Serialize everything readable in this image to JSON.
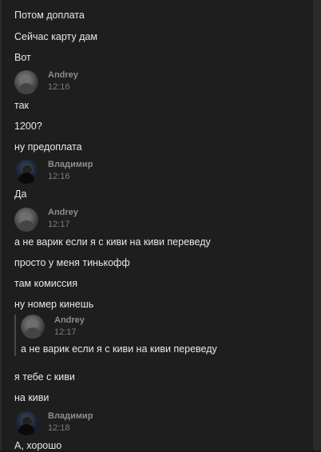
{
  "messages_top": [
    "Потом доплата",
    "Сейчас карту дам",
    "Вот"
  ],
  "group1": {
    "author": "Andrey",
    "time": "12:16",
    "messages": [
      "так",
      "1200?",
      "ну предоплата"
    ]
  },
  "group2": {
    "author": "Владимир",
    "time": "12:16",
    "messages": [
      "Да"
    ]
  },
  "group3": {
    "author": "Andrey",
    "time": "12:17",
    "messages": [
      "а не варик если я с киви на киви переведу",
      "просто у меня тинькофф",
      "там комиссия",
      "ну номер кинешь"
    ]
  },
  "quote": {
    "author": "Andrey",
    "time": "12:17",
    "text": "а не варик если я с киви на киви переведу"
  },
  "group3_after": [
    "я тебе с киви",
    "на киви"
  ],
  "group4": {
    "author": "Владимир",
    "time": "12:18",
    "messages": [
      "А, хорошо"
    ]
  },
  "avatars": {
    "andrey": "andrey-avatar-icon",
    "vladimir": "vladimir-avatar-icon"
  }
}
